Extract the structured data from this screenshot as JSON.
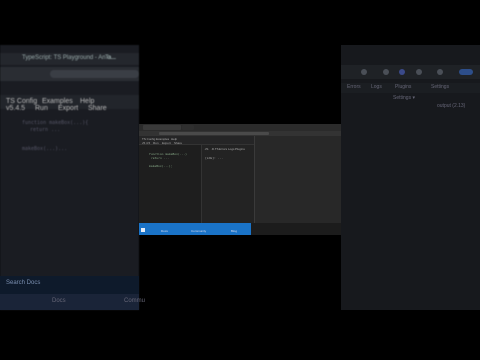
{
  "background_left": {
    "tabs": [
      "TypeScript: TS Playground - An o...",
      "Ta..."
    ],
    "menu": [
      "TS Config",
      "Examples",
      "Help"
    ],
    "toolbar": [
      "v5.4.5",
      "Run",
      "Export",
      "Share"
    ],
    "code_lines": [
      "function makeBox(...){",
      "  return ..."
    ],
    "code_lines2": [
      "makeBox(...)..."
    ],
    "search": "Search Docs",
    "bottom_labels": [
      "Docs",
      "Commu"
    ]
  },
  "background_right": {
    "row_labels": [
      "Errors",
      "Logs",
      "Plugins",
      "Settings"
    ],
    "output_label": "output (2.13)",
    "sub_label": "Settings ▾"
  },
  "window": {
    "menu": [
      "TS Config",
      "Examples",
      "Help"
    ],
    "toolbar": [
      "v5.4.5",
      "Run",
      "Export",
      "Share"
    ],
    "out_tabs": [
      ".JS",
      ".D.TS",
      "Errors",
      "Logs",
      "Plugins"
    ],
    "editor_lines": [
      "function makeBox(...)",
      "  return ...",
      "makeBox(...);"
    ],
    "output_line": "[LOG]: ...",
    "status": [
      "Docs",
      "Community",
      "Blog"
    ]
  },
  "colors": {
    "accent": "#1a73c7",
    "background": "#000000"
  }
}
